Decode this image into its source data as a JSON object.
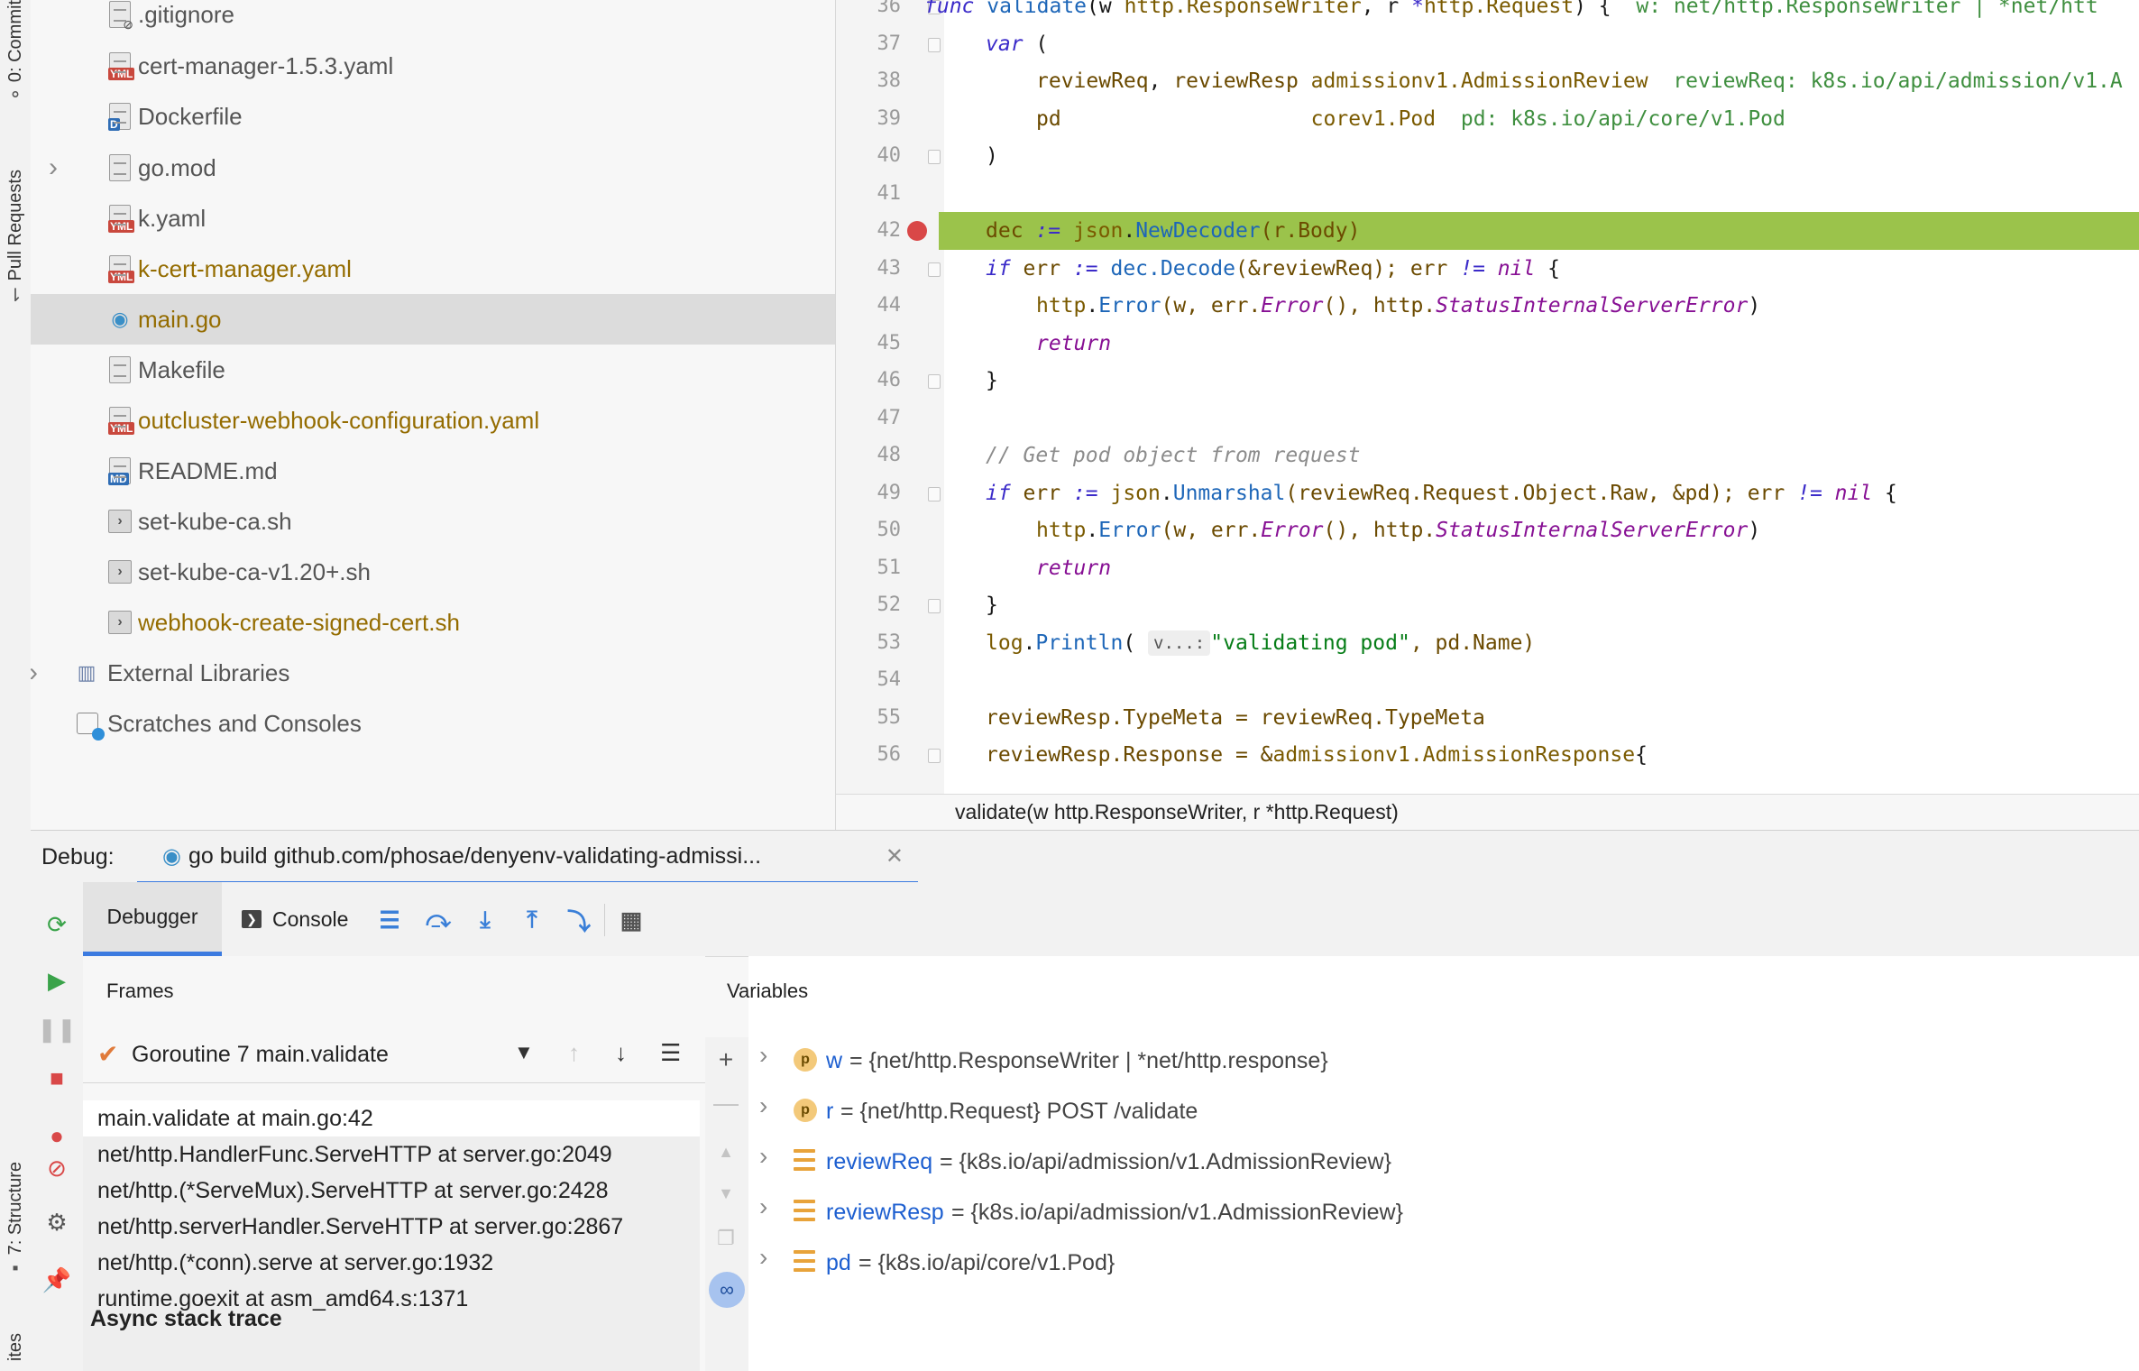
{
  "left_strip": {
    "commit_label": "0: Commit",
    "pull_requests_label": "Pull Requests",
    "structure_label": "7: Structure",
    "favorites_label": "ites"
  },
  "project_tree": {
    "items": [
      {
        "name": ".gitignore",
        "type": "gitignore",
        "color": "#555555"
      },
      {
        "name": "cert-manager-1.5.3.yaml",
        "type": "yaml",
        "color": "#555555"
      },
      {
        "name": "Dockerfile",
        "type": "docker",
        "color": "#555555"
      },
      {
        "name": "go.mod",
        "type": "gomod",
        "color": "#555555",
        "expandable": true
      },
      {
        "name": "k.yaml",
        "type": "yaml",
        "color": "#555555"
      },
      {
        "name": "k-cert-manager.yaml",
        "type": "yaml",
        "color": "#946c00"
      },
      {
        "name": "main.go",
        "type": "go",
        "color": "#946c00",
        "selected": true
      },
      {
        "name": "Makefile",
        "type": "makefile",
        "color": "#555555"
      },
      {
        "name": "outcluster-webhook-configuration.yaml",
        "type": "yaml",
        "color": "#946c00"
      },
      {
        "name": "README.md",
        "type": "md",
        "color": "#555555"
      },
      {
        "name": "set-kube-ca.sh",
        "type": "sh",
        "color": "#555555"
      },
      {
        "name": "set-kube-ca-v1.20+.sh",
        "type": "sh",
        "color": "#555555"
      },
      {
        "name": "webhook-create-signed-cert.sh",
        "type": "sh",
        "color": "#946c00"
      }
    ],
    "external_libraries": "External Libraries",
    "scratches": "Scratches and Consoles"
  },
  "editor": {
    "lines": [
      {
        "n": "36",
        "fold": true
      },
      {
        "n": "37",
        "fold": true
      },
      {
        "n": "38"
      },
      {
        "n": "39"
      },
      {
        "n": "40",
        "fold": true
      },
      {
        "n": "41"
      },
      {
        "n": "42",
        "breakpoint": true,
        "exec": true
      },
      {
        "n": "43",
        "fold": true
      },
      {
        "n": "44"
      },
      {
        "n": "45"
      },
      {
        "n": "46",
        "fold": true
      },
      {
        "n": "47"
      },
      {
        "n": "48"
      },
      {
        "n": "49",
        "fold": true
      },
      {
        "n": "50"
      },
      {
        "n": "51"
      },
      {
        "n": "52",
        "fold": true
      },
      {
        "n": "53"
      },
      {
        "n": "54"
      },
      {
        "n": "55"
      },
      {
        "n": "56",
        "fold": true
      }
    ],
    "tokens": {
      "func": "func",
      "validate": "validate",
      "sig_params_a": "(w ",
      "http_rw": "http.ResponseWriter",
      "sig_sep": ", r ",
      "ptr": "*",
      "http_req": "http.Request",
      "sig_end": ") {",
      "sig_hint": "w: net/http.ResponseWriter | *net/htt",
      "var_kw": "var",
      "var_open": " (",
      "reviewReq": "reviewReq",
      "comma": ", ",
      "reviewResp": "reviewResp",
      "admission_type": "admissionv1.AdmissionReview",
      "reviewReq_hint": "reviewReq: k8s.io/api/admission/v1.A",
      "pd": "pd",
      "pod_type": "corev1.Pod",
      "pd_hint": "pd: k8s.io/api/core/v1.Pod",
      "close_paren": ")",
      "dec": "dec",
      "assign": " := ",
      "json": "json",
      "dot": ".",
      "NewDecoder": "NewDecoder",
      "r_body": "(r.Body)",
      "if_kw": "if",
      "err": " err",
      "decode_call": "dec.Decode",
      "decode_args": "(&reviewReq); err ",
      "neq": "!=",
      "nil_kw": "nil",
      "open_brace": " {",
      "http_pkg": "http",
      "Error": "Error",
      "err_args_a": "(w, err.",
      "Error_m": "Error",
      "err_args_b": "(), http.",
      "StatusInternalServerError": "StatusInternalServerError",
      "return_kw": "return",
      "close_brace": "}",
      "comment": "// Get pod object from request",
      "Unmarshal": "Unmarshal",
      "unmarshal_args": "(reviewReq.Request.Object.Raw, &pd); err ",
      "log": "log",
      "Println": "Println",
      "println_open": "( ",
      "v_hint": "v...:",
      "validating_pod": "\"validating pod\"",
      "println_rest": ", pd.Name)",
      "line55": "reviewResp.TypeMeta = reviewReq.TypeMeta",
      "line56_a": "reviewResp.Response = &",
      "line56_b": "admissionv1.AdmissionResponse",
      "line56_c": "{"
    }
  },
  "breadcrumb": "validate(w http.ResponseWriter, r *http.Request)",
  "debug": {
    "label": "Debug:",
    "session_tab": "go build github.com/phosae/denyenv-validating-admissi...",
    "tabs": {
      "debugger": "Debugger",
      "console": "Console"
    },
    "frames_title": "Frames",
    "variables_title": "Variables",
    "goroutine": "Goroutine 7 main.validate",
    "frames": [
      "main.validate at main.go:42",
      "net/http.HandlerFunc.ServeHTTP at server.go:2049",
      "net/http.(*ServeMux).ServeHTTP at server.go:2428",
      "net/http.serverHandler.ServeHTTP at server.go:2867",
      "net/http.(*conn).serve at server.go:1932",
      "runtime.goexit at asm_amd64.s:1371"
    ],
    "async_label": "Async stack trace",
    "variables": [
      {
        "name": "w",
        "kind": "param",
        "value": "= {net/http.ResponseWriter | *net/http.response}"
      },
      {
        "name": "r",
        "kind": "param",
        "value": "= {net/http.Request} POST /validate"
      },
      {
        "name": "reviewReq",
        "kind": "field",
        "value": "= {k8s.io/api/admission/v1.AdmissionReview}"
      },
      {
        "name": "reviewResp",
        "kind": "field",
        "value": "= {k8s.io/api/admission/v1.AdmissionReview}"
      },
      {
        "name": "pd",
        "kind": "field",
        "value": "= {k8s.io/api/core/v1.Pod}"
      }
    ]
  },
  "colors": {
    "exec_line": "#9bc34b",
    "breakpoint": "#d94848",
    "accent": "#3c7be0",
    "modified_file": "#946c00"
  }
}
